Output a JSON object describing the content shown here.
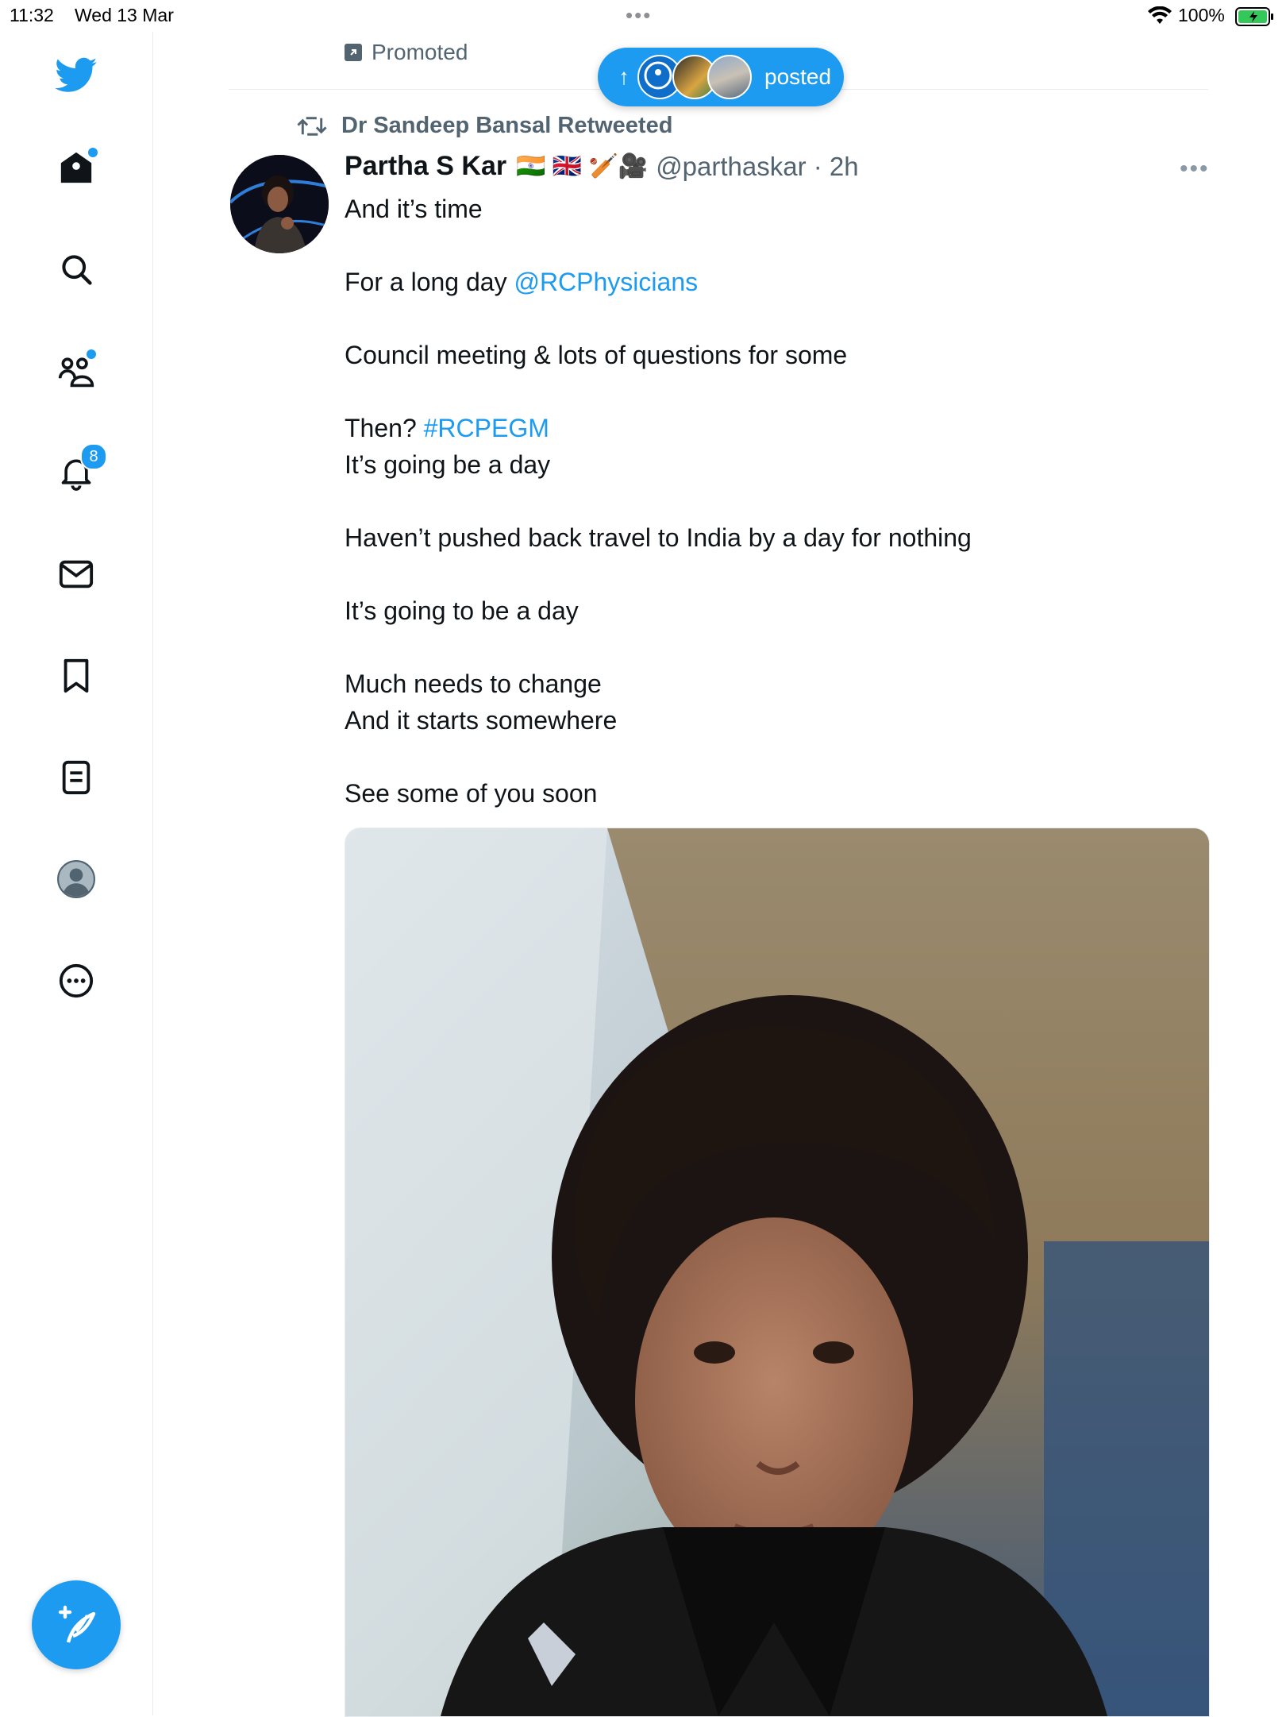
{
  "status_bar": {
    "time": "11:32",
    "date": "Wed 13 Mar",
    "battery": "100%"
  },
  "sidebar": {
    "items": [
      {
        "name": "home",
        "icon": "home-icon"
      },
      {
        "name": "explore",
        "icon": "search-icon"
      },
      {
        "name": "communities",
        "icon": "communities-icon"
      },
      {
        "name": "notifications",
        "icon": "bell-icon",
        "badge": "8"
      },
      {
        "name": "messages",
        "icon": "mail-icon"
      },
      {
        "name": "bookmarks",
        "icon": "bookmark-icon"
      },
      {
        "name": "lists",
        "icon": "lists-icon"
      },
      {
        "name": "profile",
        "icon": "profile-icon"
      },
      {
        "name": "more",
        "icon": "more-icon"
      }
    ],
    "compose_icon": "compose-icon"
  },
  "feed": {
    "promoted_label": "Promoted",
    "new_posts_pill": {
      "label": "posted"
    },
    "tweet": {
      "retweet_label": "Dr Sandeep Bansal Retweeted",
      "author_name": "Partha S Kar",
      "emojis": "🇮🇳 🇬🇧 🏏🎥",
      "handle_time": "@parthaskar · 2h",
      "lines": {
        "l1": "And it’s time",
        "l2a": "For a long day ",
        "l2b": "@RCPhysicians",
        "l3": "Council meeting & lots of questions for some",
        "l4a": "Then? ",
        "l4b": "#RCPEGM",
        "l5": "It’s going be a day",
        "l6": "Haven’t pushed back travel to India by a day for nothing",
        "l7": "It’s going to be a day",
        "l8": "Much needs to change",
        "l9": "And it starts somewhere",
        "l10": "See some of you soon"
      }
    }
  },
  "colors": {
    "accent": "#1d9bf0",
    "text": "#0f1419",
    "secondary": "#536471"
  }
}
